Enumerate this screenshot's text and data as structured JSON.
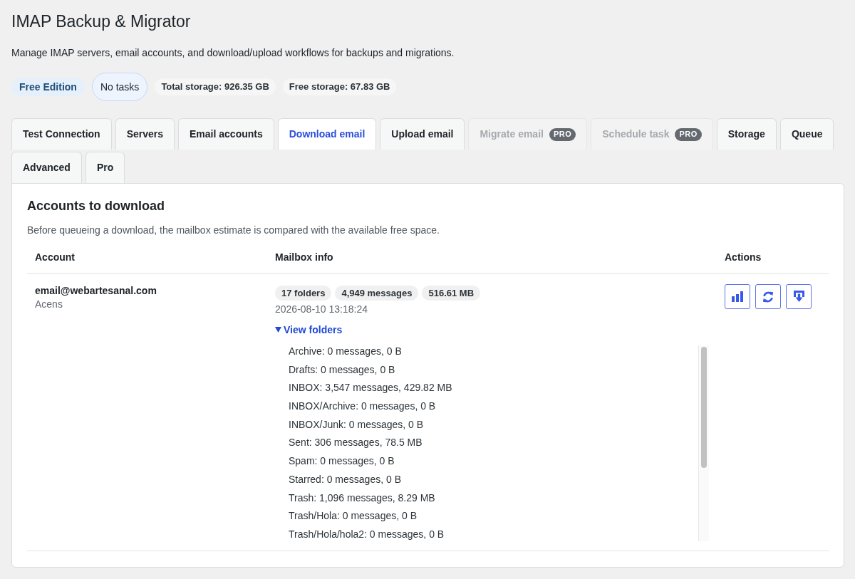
{
  "page": {
    "title": "IMAP Backup & Migrator",
    "description": "Manage IMAP servers, email accounts, and download/upload workflows for backups and migrations."
  },
  "badges": [
    {
      "label": "Free Edition",
      "kind": "edition"
    },
    {
      "label": "No tasks",
      "kind": "status"
    },
    {
      "label": "Total storage: 926.35 GB",
      "kind": "stat"
    },
    {
      "label": "Free storage: 67.83 GB",
      "kind": "stat"
    }
  ],
  "tabs": [
    {
      "label": "Test Connection",
      "selected": false,
      "disabled": false
    },
    {
      "label": "Servers",
      "selected": false,
      "disabled": false
    },
    {
      "label": "Email accounts",
      "selected": false,
      "disabled": false
    },
    {
      "label": "Download email",
      "selected": true,
      "disabled": false
    },
    {
      "label": "Upload email",
      "selected": false,
      "disabled": false
    },
    {
      "label": "Migrate email",
      "selected": false,
      "disabled": true,
      "badge": "PRO"
    },
    {
      "label": "Schedule task",
      "selected": false,
      "disabled": true,
      "badge": "PRO"
    },
    {
      "label": "Storage",
      "selected": false,
      "disabled": false
    },
    {
      "label": "Queue",
      "selected": false,
      "disabled": false
    },
    {
      "label": "Advanced",
      "selected": false,
      "disabled": false
    },
    {
      "label": "Pro",
      "selected": false,
      "disabled": false
    }
  ],
  "panel": {
    "title": "Accounts to download",
    "description": "Before queueing a download, the mailbox estimate is compared with the available free space.",
    "table": {
      "columns": [
        "Account",
        "Mailbox info",
        "Actions"
      ],
      "rows": [
        {
          "account": "email@webartesanal.com",
          "server": "Acens",
          "stats": [
            "17 folders",
            "4,949 messages",
            "516.61 MB"
          ],
          "updated": "2026-08-10 13:18:24",
          "folders_toggle": {
            "label": "View folders",
            "expanded": true
          },
          "folders": [
            "Archive: 0 messages, 0 B",
            "Drafts: 0 messages, 0 B",
            "INBOX: 3,547 messages, 429.82 MB",
            "INBOX/Archive: 0 messages, 0 B",
            "INBOX/Junk: 0 messages, 0 B",
            "Sent: 306 messages, 78.5 MB",
            "Spam: 0 messages, 0 B",
            "Starred: 0 messages, 0 B",
            "Trash: 1,096 messages, 8.29 MB",
            "Trash/Hola: 0 messages, 0 B",
            "Trash/Hola/hola2: 0 messages, 0 B"
          ]
        }
      ]
    }
  }
}
